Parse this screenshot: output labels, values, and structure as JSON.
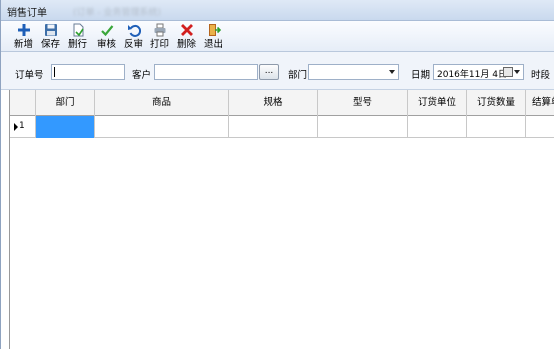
{
  "window": {
    "title": "销售订单",
    "subtitle_blurred": "(订单 - 业务管理系统)"
  },
  "toolbar": {
    "buttons": [
      {
        "id": "new",
        "label": "新增",
        "icon": "plus-icon"
      },
      {
        "id": "save",
        "label": "保存",
        "icon": "save-icon"
      },
      {
        "id": "delete_row",
        "label": "删行",
        "icon": "delete-row-icon"
      },
      {
        "id": "audit",
        "label": "审核",
        "icon": "check-icon"
      },
      {
        "id": "unaudit",
        "label": "反审",
        "icon": "undo-icon"
      },
      {
        "id": "print",
        "label": "打印",
        "icon": "print-icon"
      },
      {
        "id": "delete",
        "label": "删除",
        "icon": "x-icon"
      },
      {
        "id": "exit",
        "label": "退出",
        "icon": "exit-icon"
      }
    ]
  },
  "filters": {
    "order_no_label": "订单号",
    "order_no_value": "",
    "customer_label": "客户",
    "customer_value": "",
    "browse_label": "...",
    "dept_label": "部门",
    "dept_value": "",
    "date_label": "日期",
    "date_value": "2016年11月 4日",
    "period_label": "时段"
  },
  "grid": {
    "columns": [
      "部门",
      "商品",
      "规格",
      "型号",
      "订货单位",
      "订货数量",
      "结算单"
    ],
    "rows": [
      {
        "indicator": "1",
        "cells": [
          "",
          "",
          "",
          "",
          "",
          "",
          ""
        ]
      }
    ]
  },
  "colors": {
    "selection": "#3399ff",
    "toolbar_bg": "#e6edf7",
    "delete_red": "#d21f1f",
    "new_blue": "#1e5fb8"
  }
}
